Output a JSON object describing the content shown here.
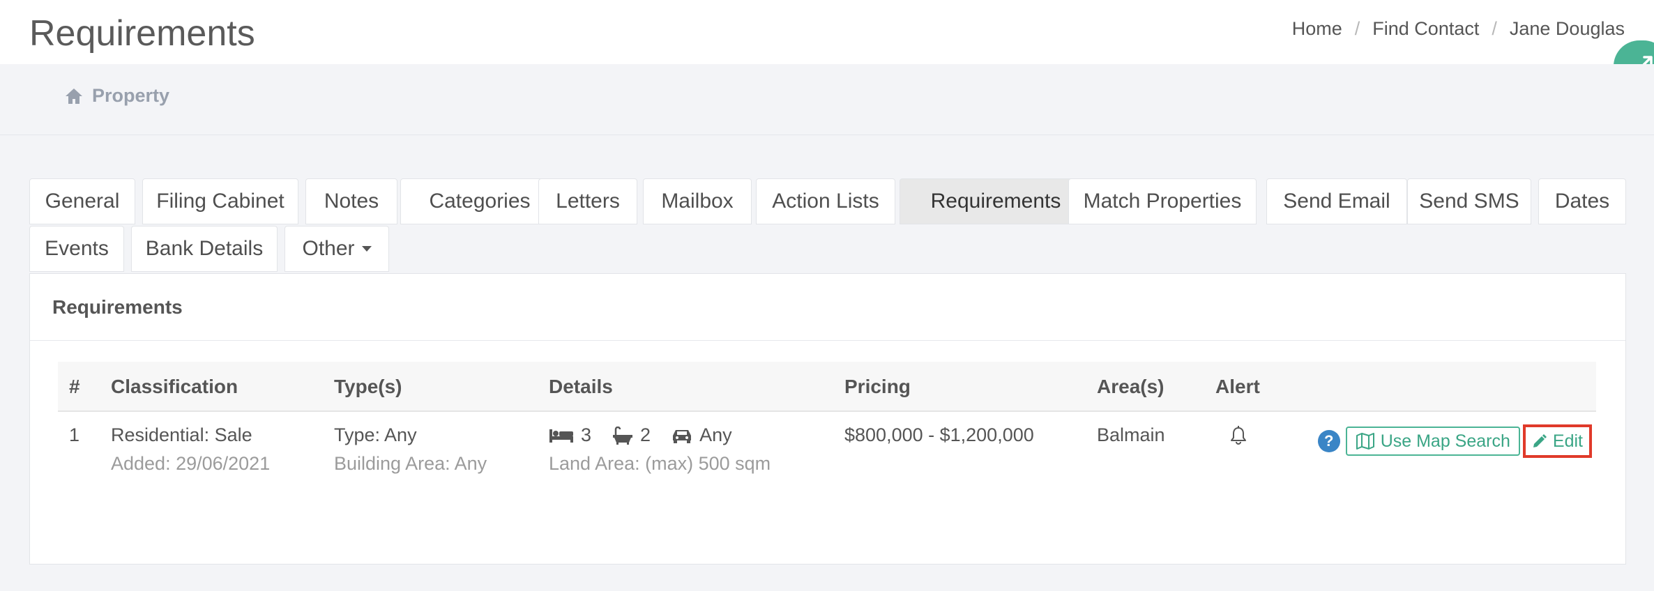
{
  "header": {
    "title": "Requirements",
    "breadcrumb": [
      "Home",
      "Find Contact",
      "Jane Douglas"
    ]
  },
  "subnav": {
    "item": "Property",
    "icon": "home-icon"
  },
  "tabs": [
    "General",
    "Filing Cabinet",
    "Notes",
    "Categories",
    "Letters",
    "Mailbox",
    "Action Lists",
    "Requirements",
    "Match Properties",
    "Send Email",
    "Send SMS",
    "Dates",
    "Events",
    "Bank Details",
    "Other"
  ],
  "active_tab": "Requirements",
  "panel": {
    "title": "Requirements",
    "columns": [
      "#",
      "Classification",
      "Type(s)",
      "Details",
      "Pricing",
      "Area(s)",
      "Alert"
    ],
    "rows": [
      {
        "num": "1",
        "classification": "Residential: Sale",
        "added": "Added: 29/06/2021",
        "type": "Type: Any",
        "building_area": "Building Area: Any",
        "beds": "3",
        "baths": "2",
        "cars": "Any",
        "land_area": "Land Area: (max) 500 sqm",
        "pricing": "$800,000 - $1,200,000",
        "areas": "Balmain",
        "help_label": "?",
        "map_button": "Use Map Search",
        "edit_button": "Edit"
      }
    ]
  },
  "colors": {
    "accent": "#4bb495",
    "highlight": "#e03a2a",
    "help": "#3a85c6"
  }
}
